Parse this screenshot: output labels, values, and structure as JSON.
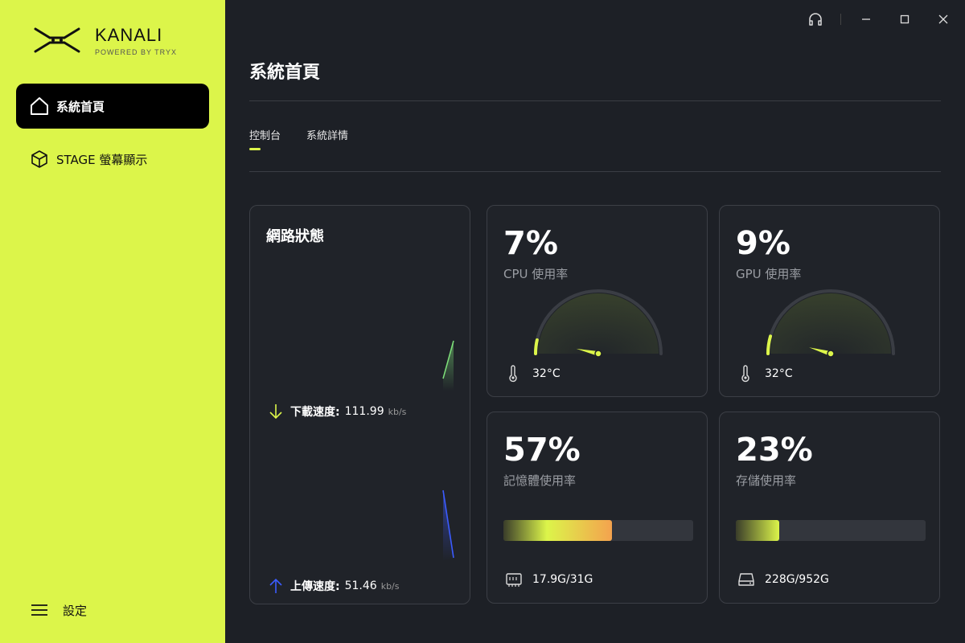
{
  "app": {
    "name": "KANALI",
    "tagline": "POWERED BY TRYX"
  },
  "sidebar": {
    "items": [
      {
        "label": "系統首頁",
        "icon": "home-icon",
        "active": true
      },
      {
        "label": "STAGE 螢幕顯示",
        "icon": "cube-icon",
        "active": false
      }
    ],
    "settings_label": "設定"
  },
  "page": {
    "title": "系統首頁"
  },
  "tabs": [
    {
      "label": "控制台",
      "active": true
    },
    {
      "label": "系統詳情",
      "active": false
    }
  ],
  "network": {
    "title": "網路狀態",
    "download": {
      "label": "下載速度:",
      "value": "111.99",
      "unit": "kb/s"
    },
    "upload": {
      "label": "上傳速度:",
      "value": "51.46",
      "unit": "kb/s"
    }
  },
  "cpu": {
    "percent_text": "7%",
    "label": "CPU 使用率",
    "temp": "32°C",
    "value": 0.07
  },
  "gpu": {
    "percent_text": "9%",
    "label": "GPU 使用率",
    "temp": "32°C",
    "value": 0.09
  },
  "memory": {
    "percent_text": "57%",
    "label": "記憶體使用率",
    "usage": "17.9G/31G",
    "value": 0.57
  },
  "storage": {
    "percent_text": "23%",
    "label": "存儲使用率",
    "usage": "228G/952G",
    "value": 0.23
  },
  "colors": {
    "accent": "#dcf54a",
    "download": "#7ee07a",
    "upload": "#3b5bff",
    "background": "#1d2026"
  }
}
